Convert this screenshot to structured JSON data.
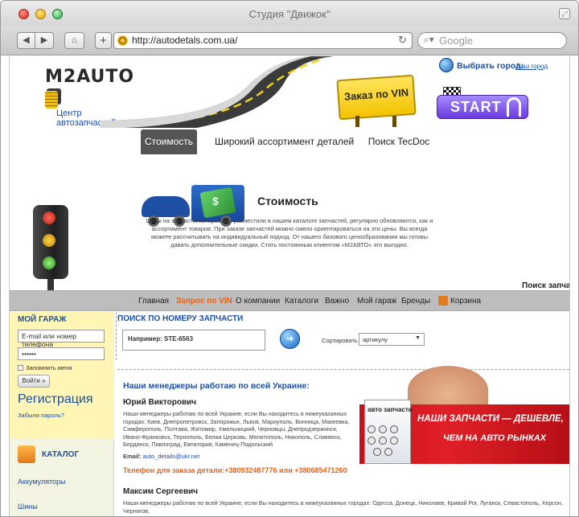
{
  "browser": {
    "window_title": "Студия \"Движок\"",
    "url": "http://autodetals.com.ua/",
    "search_placeholder": "Google",
    "back_icon": "chevron-left-icon",
    "forward_icon": "chevron-right-icon",
    "home_icon": "home-icon",
    "add_icon": "plus-icon",
    "reload_icon": "reload-icon"
  },
  "header": {
    "logo_text": "M2AUTO",
    "logo_subtitle": "Центр автозапчастей",
    "vin_sign": "Заказ по VIN",
    "city_label": "Выбрать город:",
    "city_link": "Ваш город",
    "start_label": "START"
  },
  "tabs": [
    {
      "label": "Стоимость",
      "active": true
    },
    {
      "label": "Широкий ассортимент деталей",
      "active": false
    },
    {
      "label": "Поиск TecDoc",
      "active": false
    }
  ],
  "feature": {
    "title": "Стоимость",
    "text": "Цены на запчасти, которые мы разместили в нашем каталоге запчастей, регулярно обновляются, как и ассортимент товаров. При заказе запчастей можно смело ориентироваться на эти цены. Вы всегда можете рассчитывать на индивидуальный подход. От нашего базового ценообразования мы готовы давать дополнительные скидки. Стать постоянным клиентом «M2АВТО» это выгодно."
  },
  "nav": {
    "items": [
      "Главная",
      "Запрос по VIN",
      "О компании",
      "Каталоги",
      "Важно",
      "Мой гараж",
      "Бренды",
      "Корзина"
    ],
    "active_index": 1,
    "part_search_label": "Поиск запчаст"
  },
  "sidebar": {
    "garage_title": "МОЙ ГАРАЖ",
    "login_placeholder": "E-mail или номер телефона",
    "password_value": "••••••",
    "remember_label": "Запомнить меня",
    "login_button": "Войти »",
    "register_link": "Регистрация",
    "forgot_link": "Забыли пароль?",
    "catalog_title": "КАТАЛОГ",
    "catalog_items": [
      "Аккумуляторы",
      "Шины"
    ]
  },
  "search": {
    "heading": "ПОИСК ПО НОМЕРУ ЗАПЧАСТИ",
    "input_placeholder": "Например: STE-6563",
    "sort_label": "Сортировать по",
    "sort_selected": "артикулу"
  },
  "managers": {
    "title": "Наши менеджеры работаю по всей Украине:",
    "people": [
      {
        "name": "Юрий Викторович",
        "text": "Наши менеджеры работаю по всей Украине, если Вы находитесь в нижеуказанных городах: Киев, Днепропетровск, Запорожье, Львов, Мариуполь, Винница, Макеевка, Симферополь, Полтава, Житомир, Хмельницкий, Черновцы, Днепродзержинск, Ивано-Франковск, Тернополь, Белая Церковь, Мелитополь, Никополь, Славянск, Бердянск, Павлоград, Евпатория, Каменец-Подольский",
        "email_label": "Email:",
        "email": "auto_details@ukr.net"
      },
      {
        "name": "Максим Сергеевич",
        "text": "Наши менеджеры работаю по всей Украине, если Вы находитесь в нижеуказанных городах: Одесса, Донецк, Николаев, Кривой Рог, Луганск, Севастополь, Херсон, Чернигов,"
      }
    ],
    "phone_line": "Телефон для заказа детали:+380932487776 или +380685471260"
  },
  "banner": {
    "box_label": "авто запчасти",
    "line1": "НАШИ ЗАПЧАСТИ — ДЕШЕВЛЕ,",
    "line2": "ЧЕМ НА АВТО РЫНКАХ"
  },
  "colors": {
    "link_blue": "#1a4fa3",
    "accent_orange": "#e8621a",
    "tab_active_bg": "#555555",
    "nav_band": "#bdbdbd",
    "garage_bg": "#fff5b5",
    "banner_red": "#e02028"
  }
}
